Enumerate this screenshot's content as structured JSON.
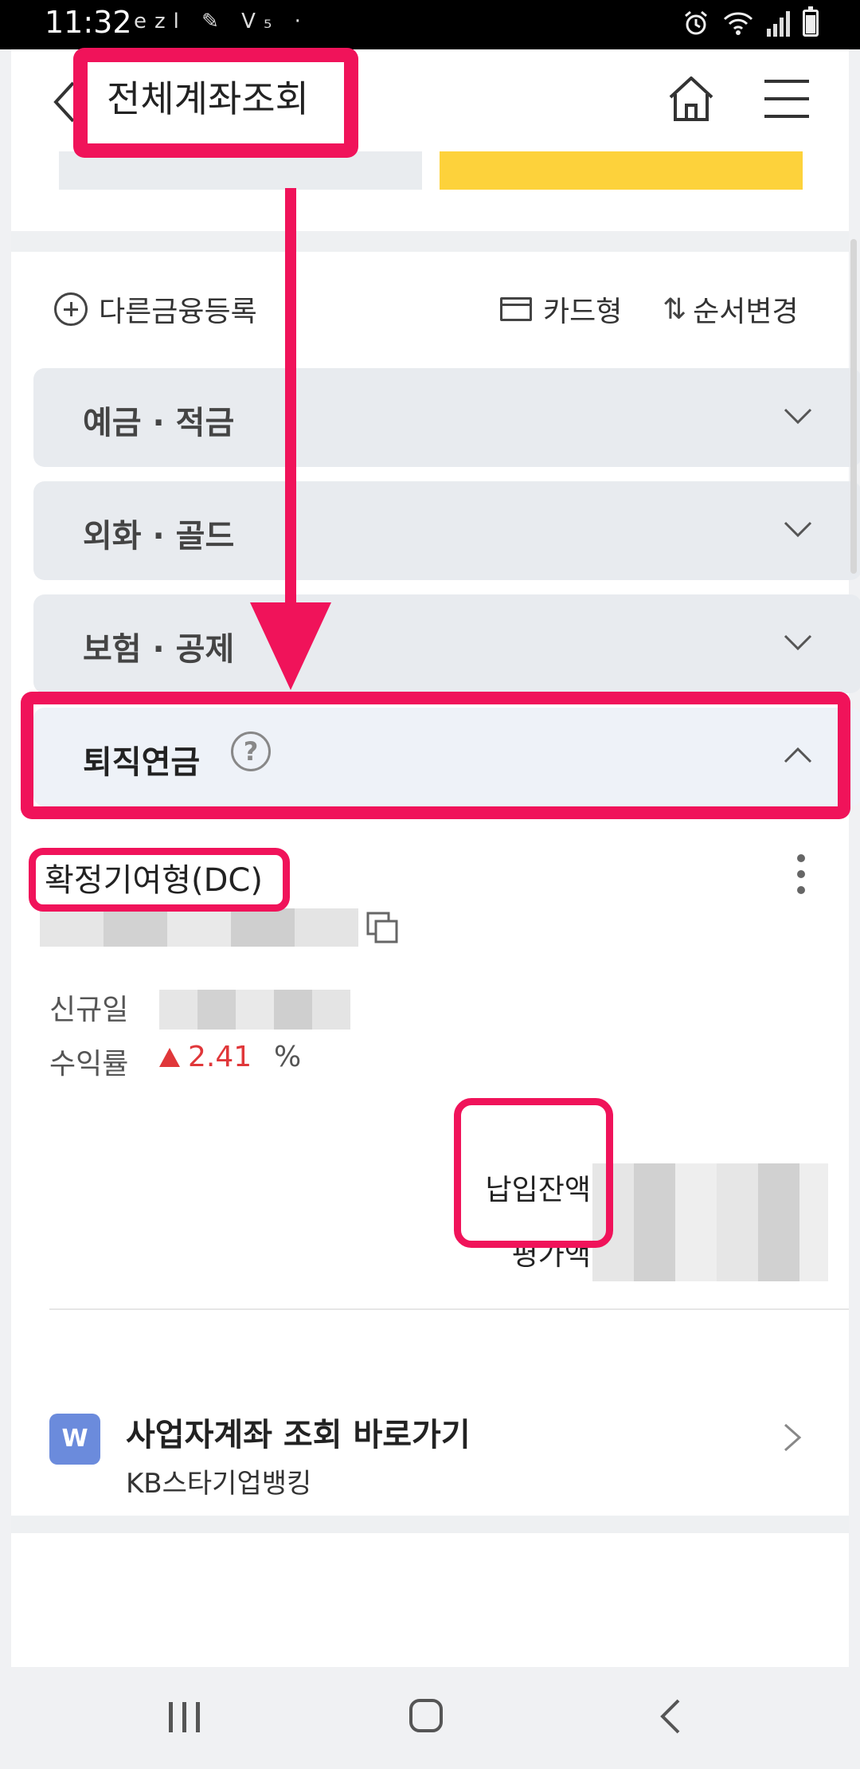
{
  "status_bar": {
    "time": "11:32",
    "left_icons": "ezl ✎ V₅ ·"
  },
  "header": {
    "title": "전체계좌조회"
  },
  "toolbar": {
    "add_label": "다른금융등록",
    "card_label": "카드형",
    "order_label": "순서변경"
  },
  "categories": [
    {
      "label": "예금 · 적금",
      "expanded": false
    },
    {
      "label": "외화 · 골드",
      "expanded": false
    },
    {
      "label": "보험 · 공제",
      "expanded": false
    },
    {
      "label": "퇴직연금",
      "expanded": true
    }
  ],
  "account": {
    "type": "확정기여형(DC)",
    "new_date_label": "신규일",
    "return_rate_label": "수익률",
    "return_rate_value": "2.41",
    "return_rate_unit": "%",
    "paid_balance_label": "납입잔액",
    "eval_amount_label": "평가액"
  },
  "business_shortcut": {
    "icon_letter": "W",
    "title": "사업자계좌 조회 바로가기",
    "subtitle": "KB스타기업뱅킹"
  },
  "colors": {
    "accent_yellow": "#fdd23b",
    "annotation_pink": "#f0135a",
    "rate_red": "#e0373a",
    "biz_icon_blue": "#6b8bdc"
  }
}
